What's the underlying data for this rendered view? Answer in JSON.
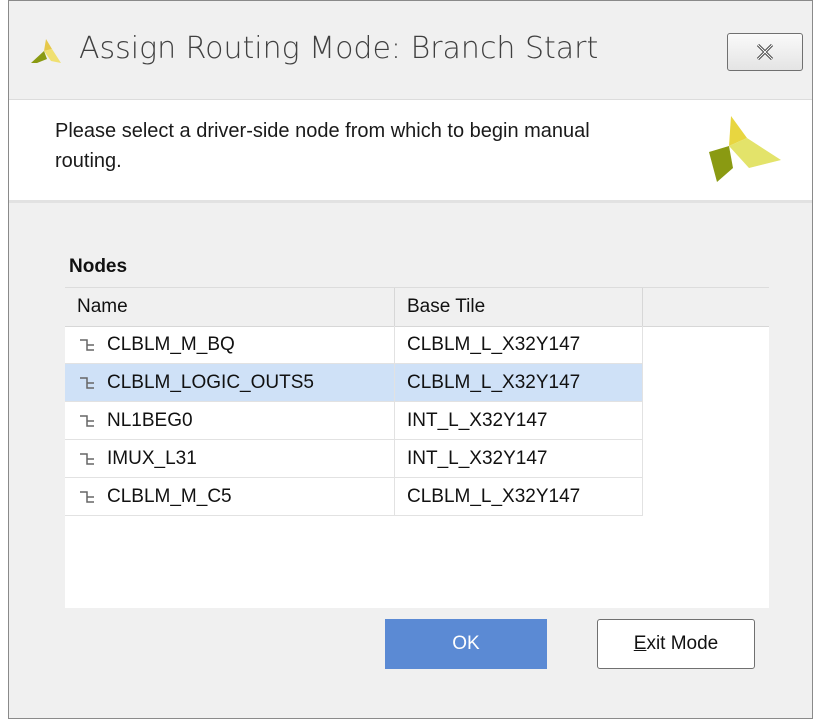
{
  "window": {
    "title": "Assign Routing Mode: Branch Start",
    "close_icon": "close-x-icon"
  },
  "banner": {
    "message": "Please select a driver-side node from which to begin manual routing.",
    "logo_icon": "vivado-logo-icon"
  },
  "nodes_panel": {
    "label": "Nodes",
    "columns": [
      "Name",
      "Base Tile"
    ],
    "rows": [
      {
        "name": "CLBLM_M_BQ",
        "base_tile": "CLBLM_L_X32Y147",
        "selected": false
      },
      {
        "name": "CLBLM_LOGIC_OUTS5",
        "base_tile": "CLBLM_L_X32Y147",
        "selected": true
      },
      {
        "name": "NL1BEG0",
        "base_tile": "INT_L_X32Y147",
        "selected": false
      },
      {
        "name": "IMUX_L31",
        "base_tile": "INT_L_X32Y147",
        "selected": false
      },
      {
        "name": "CLBLM_M_C5",
        "base_tile": "CLBLM_L_X32Y147",
        "selected": false
      }
    ],
    "row_icon": "node-wire-icon"
  },
  "buttons": {
    "ok_label": "OK",
    "exit_mnemonic": "E",
    "exit_rest": "xit Mode"
  },
  "colors": {
    "selection": "#cfe1f7",
    "ok_button": "#5b8ad4",
    "logo_dark": "#8a9a12",
    "logo_light": "#e3e36a"
  }
}
